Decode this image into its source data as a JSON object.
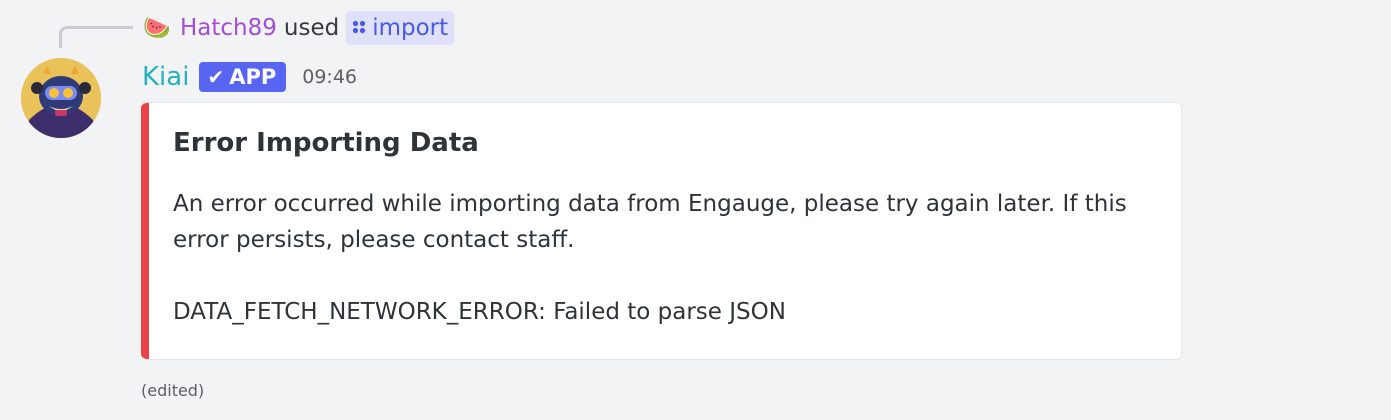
{
  "reply": {
    "emoji": "🍉",
    "username": "Hatch89",
    "used_text": "used",
    "command_icon": "app-command-icon",
    "command_name": "import"
  },
  "message": {
    "author": "Kiai",
    "badge": {
      "check": "✔",
      "label": "APP"
    },
    "timestamp": "09:46",
    "edited_label": "(edited)"
  },
  "embed": {
    "accent_color": "#ed4245",
    "title": "Error Importing Data",
    "description_line_1": "An error occurred while importing data from Engauge, please try again later. If this error persists, please contact staff.",
    "description_line_2": "DATA_FETCH_NETWORK_ERROR: Failed to parse JSON"
  },
  "colors": {
    "reply_username": "#a14fd6",
    "author": "#25b2bd",
    "app_badge": "#5865f2",
    "command_pill_bg": "#dfe1fb",
    "command_pill_text": "#4a5ae6"
  }
}
